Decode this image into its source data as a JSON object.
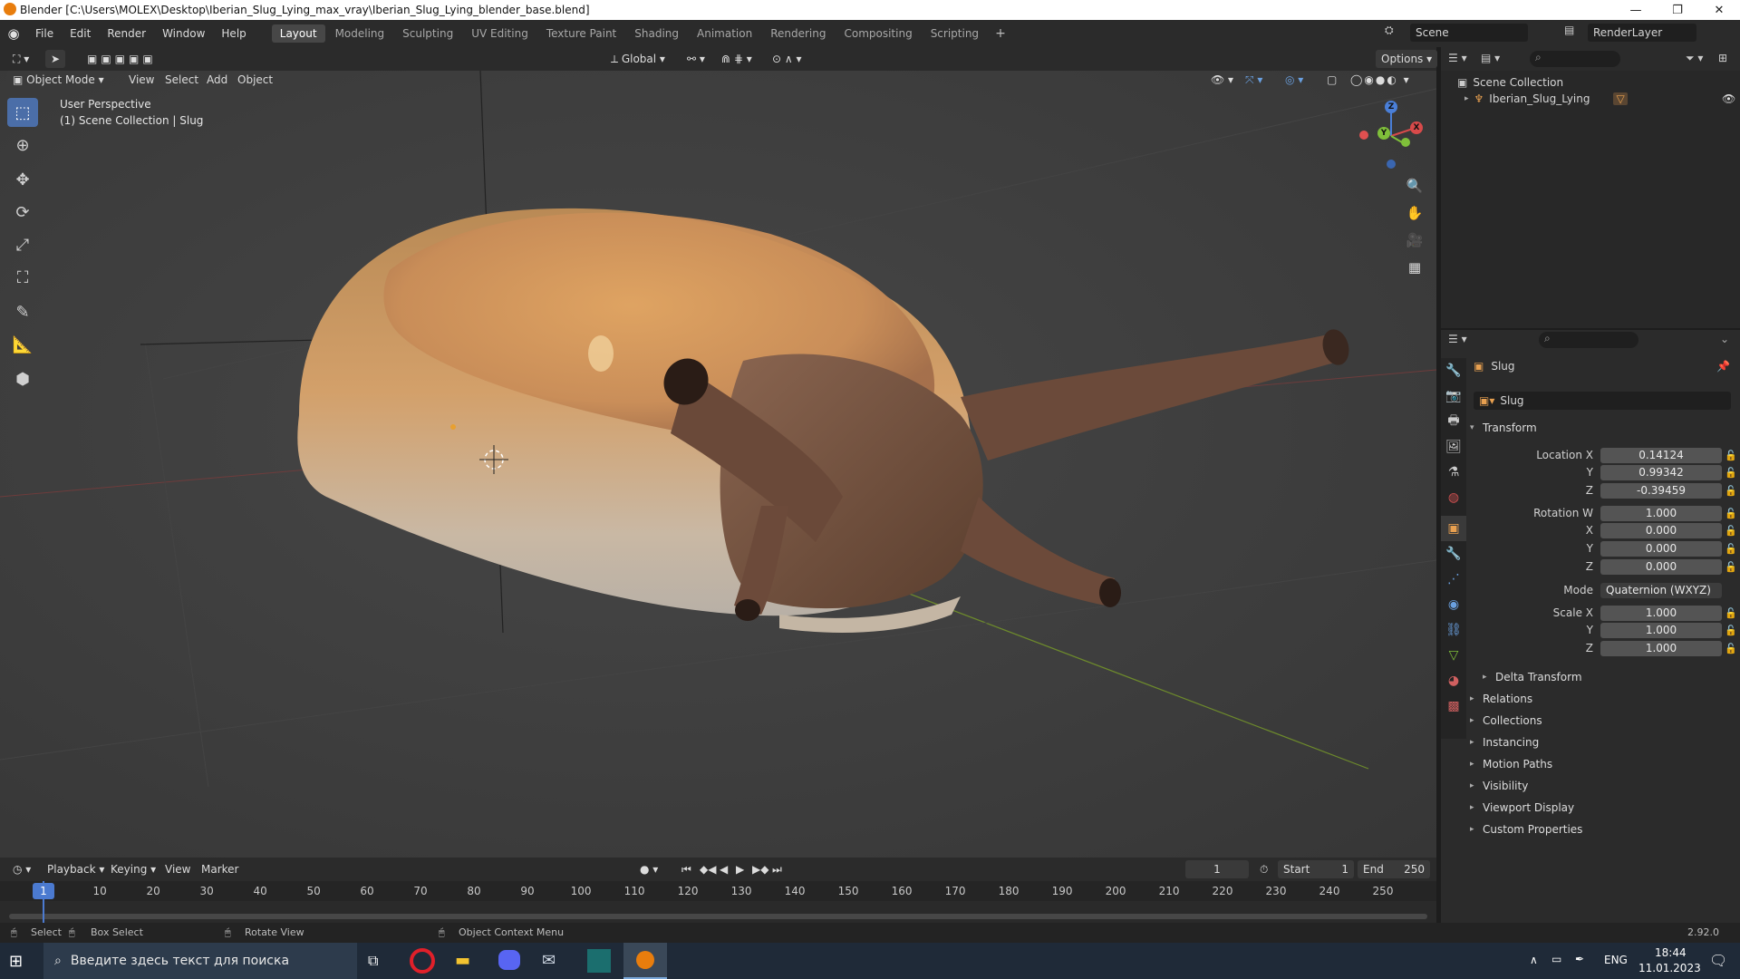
{
  "window": {
    "title": "Blender [C:\\Users\\MOLEX\\Desktop\\Iberian_Slug_Lying_max_vray\\Iberian_Slug_Lying_blender_base.blend]"
  },
  "menu": [
    "File",
    "Edit",
    "Render",
    "Window",
    "Help"
  ],
  "workspaces": [
    "Layout",
    "Modeling",
    "Sculpting",
    "UV Editing",
    "Texture Paint",
    "Shading",
    "Animation",
    "Rendering",
    "Compositing",
    "Scripting"
  ],
  "scene": {
    "name": "Scene",
    "render_layer": "RenderLayer"
  },
  "viewport_header": {
    "mode": "Object Mode",
    "menus": [
      "View",
      "Select",
      "Add",
      "Object"
    ],
    "transform_orientation": "Global",
    "options": "Options"
  },
  "viewport": {
    "perspective": "User Perspective",
    "collection_info": "(1) Scene Collection | Slug",
    "gizmo": {
      "x": "X",
      "y": "Y",
      "z": "Z"
    }
  },
  "outliner": {
    "root": "Scene Collection",
    "items": [
      {
        "name": "Iberian_Slug_Lying"
      }
    ]
  },
  "properties": {
    "object_name": "Slug",
    "datablock": "Slug",
    "transform_title": "Transform",
    "location": {
      "label_x": "Location X",
      "x": "0.14124",
      "y": "0.99342",
      "z": "-0.39459"
    },
    "rotation": {
      "label_w": "Rotation W",
      "w": "1.000",
      "x": "0.000",
      "y": "0.000",
      "z": "0.000"
    },
    "mode_label": "Mode",
    "mode_value": "Quaternion (WXYZ)",
    "scale": {
      "label_x": "Scale X",
      "x": "1.000",
      "y": "1.000",
      "z": "1.000"
    },
    "axis_y": "Y",
    "axis_z": "Z",
    "axis_x": "X",
    "delta_transform": "Delta Transform",
    "panels": [
      "Relations",
      "Collections",
      "Instancing",
      "Motion Paths",
      "Visibility",
      "Viewport Display",
      "Custom Properties"
    ]
  },
  "timeline": {
    "menus": [
      "Playback",
      "Keying",
      "View",
      "Marker"
    ],
    "current_frame": "1",
    "start_label": "Start",
    "start": "1",
    "end_label": "End",
    "end": "250",
    "ticks": [
      "1",
      "10",
      "20",
      "30",
      "40",
      "50",
      "60",
      "70",
      "80",
      "90",
      "100",
      "110",
      "120",
      "130",
      "140",
      "150",
      "160",
      "170",
      "180",
      "190",
      "200",
      "210",
      "220",
      "230",
      "240",
      "250"
    ]
  },
  "statusbar": {
    "select": "Select",
    "box_select": "Box Select",
    "rotate_view": "Rotate View",
    "context_menu": "Object Context Menu",
    "version": "2.92.0"
  },
  "taskbar": {
    "search_placeholder": "Введите здесь текст для поиска",
    "language": "ENG",
    "time": "18:44",
    "date": "11.01.2023"
  }
}
